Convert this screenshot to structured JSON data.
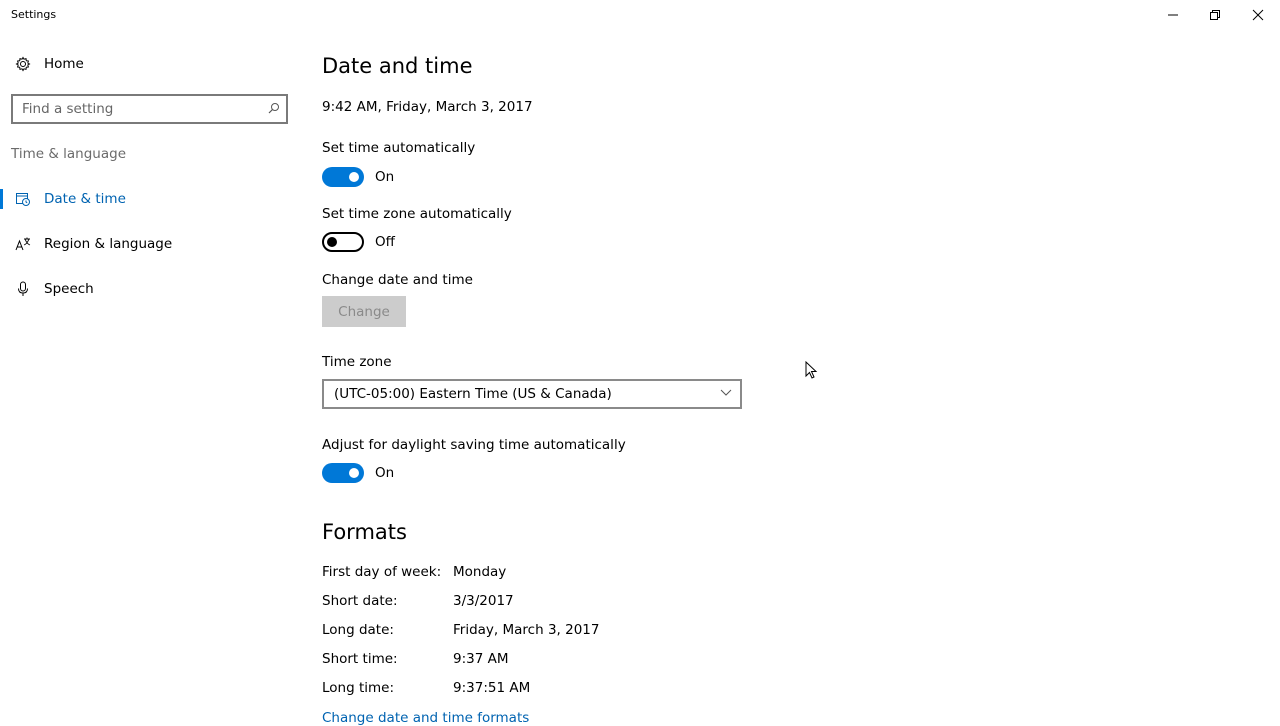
{
  "window": {
    "title": "Settings"
  },
  "sidebar": {
    "home_label": "Home",
    "search_placeholder": "Find a setting",
    "section_label": "Time & language",
    "items": [
      {
        "label": "Date & time",
        "icon": "calendar-clock-icon",
        "active": true
      },
      {
        "label": "Region & language",
        "icon": "language-icon",
        "active": false
      },
      {
        "label": "Speech",
        "icon": "microphone-icon",
        "active": false
      }
    ]
  },
  "main": {
    "title": "Date and time",
    "current_datetime": "9:42 AM, Friday, March 3, 2017",
    "set_time_auto": {
      "label": "Set time automatically",
      "state": "On"
    },
    "set_timezone_auto": {
      "label": "Set time zone automatically",
      "state": "Off"
    },
    "change_datetime": {
      "label": "Change date and time",
      "button": "Change"
    },
    "time_zone": {
      "label": "Time zone",
      "value": "(UTC-05:00) Eastern Time (US & Canada)"
    },
    "daylight": {
      "label": "Adjust for daylight saving time automatically",
      "state": "On"
    },
    "formats": {
      "title": "Formats",
      "rows": [
        {
          "key": "First day of week:",
          "value": "Monday"
        },
        {
          "key": "Short date:",
          "value": "3/3/2017"
        },
        {
          "key": "Long date:",
          "value": "Friday, March 3, 2017"
        },
        {
          "key": "Short time:",
          "value": "9:37 AM"
        },
        {
          "key": "Long time:",
          "value": "9:37:51 AM"
        }
      ],
      "link": "Change date and time formats"
    }
  },
  "colors": {
    "accent": "#0078d7",
    "link": "#0063b1"
  }
}
